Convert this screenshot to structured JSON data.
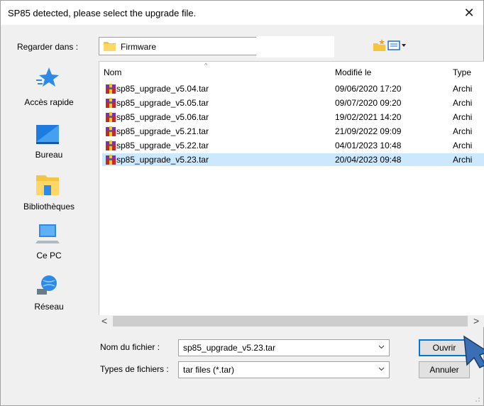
{
  "window": {
    "title": "SP85 detected, please select the upgrade file.",
    "close_label": "✕"
  },
  "lookin": {
    "label": "Regarder dans :",
    "folder": "Firmware"
  },
  "places": [
    {
      "label": "Accès rapide",
      "icon": "quick-access-star-icon"
    },
    {
      "label": "Bureau",
      "icon": "desktop-icon"
    },
    {
      "label": "Bibliothèques",
      "icon": "libraries-icon"
    },
    {
      "label": "Ce PC",
      "icon": "computer-icon"
    },
    {
      "label": "Réseau",
      "icon": "network-icon"
    }
  ],
  "columns": {
    "name": "Nom",
    "modified": "Modifié le",
    "type": "Type"
  },
  "files": [
    {
      "name": "sp85_upgrade_v5.04.tar",
      "date": "09/06/2020 17:20",
      "type": "Archi"
    },
    {
      "name": "sp85_upgrade_v5.05.tar",
      "date": "09/07/2020 09:20",
      "type": "Archi"
    },
    {
      "name": "sp85_upgrade_v5.06.tar",
      "date": "19/02/2021 14:20",
      "type": "Archi"
    },
    {
      "name": "sp85_upgrade_v5.21.tar",
      "date": "21/09/2022 09:09",
      "type": "Archi"
    },
    {
      "name": "sp85_upgrade_v5.22.tar",
      "date": "04/01/2023 10:48",
      "type": "Archi"
    },
    {
      "name": "sp85_upgrade_v5.23.tar",
      "date": "20/04/2023 09:48",
      "type": "Archi",
      "selected": true
    }
  ],
  "scroll": {
    "left": "<",
    "right": ">"
  },
  "filename": {
    "label": "Nom du fichier :",
    "value": "sp85_upgrade_v5.23.tar"
  },
  "filetype": {
    "label": "Types de fichiers :",
    "value": "tar files (*.tar)"
  },
  "buttons": {
    "open": "Ouvrir",
    "cancel": "Annuler"
  },
  "colors": {
    "selection": "#cce8ff",
    "accent": "#0078d7",
    "cursor": "#3a6fb5"
  }
}
